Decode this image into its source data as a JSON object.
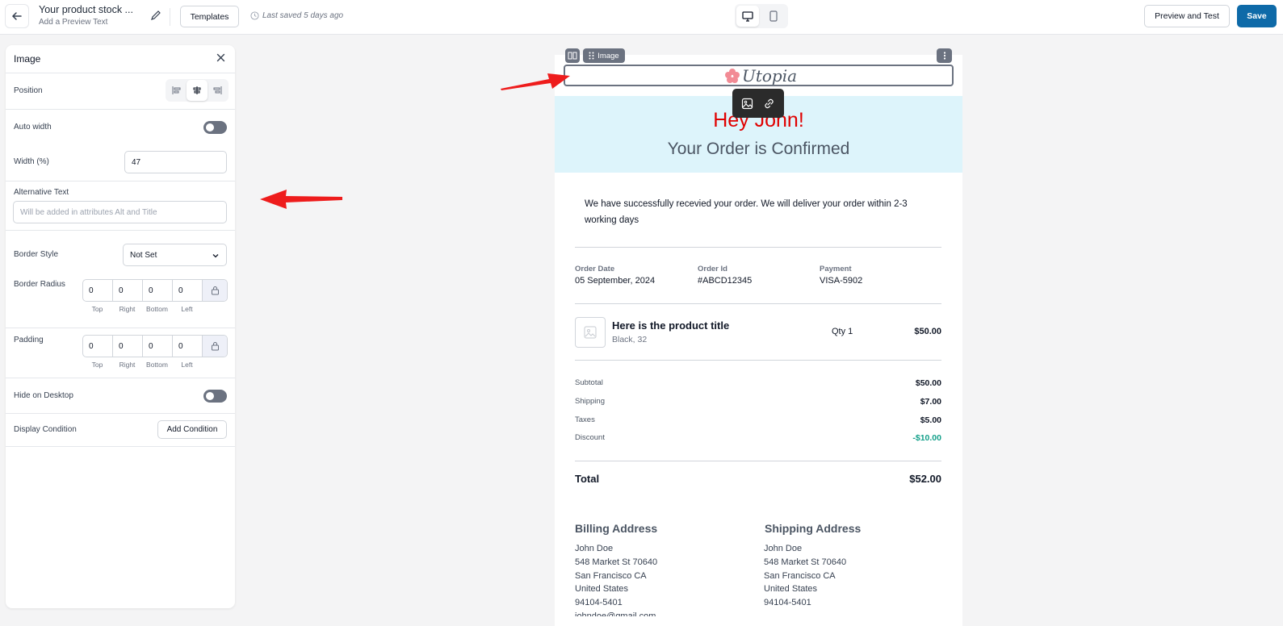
{
  "topbar": {
    "doc_title": "Your product stock ...",
    "doc_subtitle": "Add a Preview Text",
    "templates_label": "Templates",
    "last_saved": "Last saved 5 days ago",
    "preview_label": "Preview and Test",
    "save_label": "Save"
  },
  "panel": {
    "title": "Image",
    "position_label": "Position",
    "auto_width_label": "Auto width",
    "width_label": "Width (%)",
    "width_value": "47",
    "alt_label": "Alternative Text",
    "alt_placeholder": "Will be added in attributes Alt and Title",
    "border_style_label": "Border Style",
    "border_style_value": "Not Set",
    "border_radius_label": "Border Radius",
    "border_radius": [
      "0",
      "0",
      "0",
      "0"
    ],
    "padding_label": "Padding",
    "padding": [
      "0",
      "0",
      "0",
      "0"
    ],
    "sides": [
      "Top",
      "Right",
      "Bottom",
      "Left"
    ],
    "hide_desktop_label": "Hide on Desktop",
    "display_condition_label": "Display Condition",
    "add_condition_label": "Add Condition"
  },
  "email": {
    "block_chip": "Image",
    "logo_text": "Utopia",
    "greeting": "Hey John!",
    "headline": "Your Order is Confirmed",
    "intro": "We have successfully recevied your order. We will deliver your order within 2-3 working days",
    "meta": [
      {
        "label": "Order Date",
        "value": "05 September, 2024"
      },
      {
        "label": "Order Id",
        "value": "#ABCD12345"
      },
      {
        "label": "Payment",
        "value": "VISA-5902"
      }
    ],
    "product": {
      "title": "Here is the product title",
      "variant": "Black, 32",
      "qty": "Qty 1",
      "price": "$50.00"
    },
    "summary": [
      {
        "label": "Subtotal",
        "value": "$50.00"
      },
      {
        "label": "Shipping",
        "value": "$7.00"
      },
      {
        "label": "Taxes",
        "value": "$5.00"
      },
      {
        "label": "Discount",
        "value": "-$10.00"
      }
    ],
    "total_label": "Total",
    "total_value": "$52.00",
    "billing": {
      "heading": "Billing Address",
      "lines": [
        "John Doe",
        "548 Market St 70640",
        "San Francisco CA",
        "United States",
        "94104-5401",
        "johndoe@gmail.com"
      ]
    },
    "shipping": {
      "heading": "Shipping Address",
      "lines": [
        "John Doe",
        "548 Market St 70640",
        "San Francisco CA",
        "United States",
        "94104-5401"
      ]
    }
  },
  "colors": {
    "accent": "#0e6aa8",
    "greeting": "#e00000",
    "hero_bg": "#ddf4fb",
    "discount": "#14a08a",
    "annotation_arrow": "#ee1c1c"
  }
}
